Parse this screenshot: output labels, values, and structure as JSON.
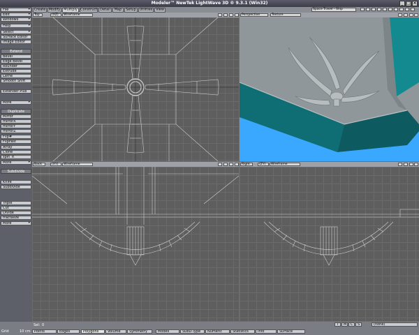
{
  "window": {
    "title": "Modeler™ NewTek LightWave 3D ® 9.3.1 (Win32)",
    "minimize": "_",
    "maximize": "□",
    "close": "×"
  },
  "sidebar": {
    "top_menu": [
      "File",
      "Edit",
      "Windows",
      "Help",
      "Select"
    ],
    "top_plain": [
      "Surface Editor",
      "Image Editor"
    ],
    "extend_header": "Extend",
    "extend_items": [
      "Bevel",
      "Edge Bevel",
      "Rounder",
      "Extrude",
      "Lathe",
      "Smooth Shift"
    ],
    "extender_plus": "Extender Plus",
    "more_label": "More",
    "duplicate_header": "Duplicate",
    "duplicate_items": [
      "Mirror",
      "mirrorX",
      "mirrorY",
      "mirrorZ",
      "Flip#",
      "FlipFast",
      "Array",
      "Clone",
      "spin_it"
    ],
    "subdivide_header": "Subdivide",
    "subdivide_items_a": [
      "Knife",
      "Subdivide"
    ],
    "subdivide_items_b": [
      "Triple",
      "Cut",
      "Divide",
      "fractalize"
    ]
  },
  "tabs": [
    "Create",
    "Modify",
    "Multiply",
    "Construct",
    "Detail",
    "Map",
    "Setup",
    "Utilities",
    "View"
  ],
  "active_tab": "Multiply",
  "scene_selector": "Space Travel - Ship",
  "viewports": {
    "top_left": {
      "view": "Top",
      "axis": "(XZ)",
      "mode": "Wireframe"
    },
    "top_right": {
      "view": "Perspective",
      "mode": "Texture"
    },
    "bottom_left": {
      "view": "Back",
      "axis": "(XY)",
      "mode": "Wireframe"
    },
    "bottom_right": {
      "view": "Right",
      "axis": "(ZY)",
      "mode": "Wireframe"
    }
  },
  "status": {
    "grid_label": "Grid",
    "grid_value": "10 cm",
    "sel_label": "Sel:",
    "sel_value": "0",
    "tmcs": [
      "T",
      "M",
      "C",
      "S"
    ],
    "layer_value": "(none)"
  },
  "bottom_buttons": [
    "Points",
    "Edges",
    "Polygons",
    "Volume",
    "Symmetry",
    "Modes",
    "SubD-Type",
    "Numeric",
    "Statistics",
    "Info",
    "Surface"
  ],
  "active_bottom": "Polygons",
  "colors": {
    "sky": "#3aa8ff",
    "hull_teal": "#0f6e74",
    "hull_gray": "#8f979b",
    "wire": "#d8d8d8"
  }
}
